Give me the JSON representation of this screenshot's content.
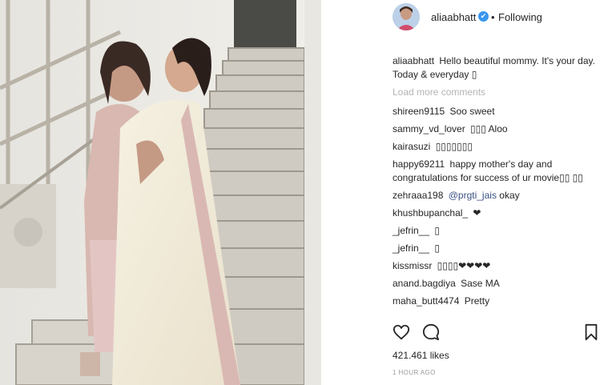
{
  "post": {
    "image_alt": "Two women embracing on a staircase",
    "header": {
      "username": "aliaabhatt",
      "verified_mark": "✔",
      "separator": "•",
      "follow_status": "Following"
    },
    "caption": {
      "username": "aliaabhatt",
      "text": "Hello beautiful mommy. It's your day. Today & everyday ▯"
    },
    "load_more": "Load more comments",
    "comments": [
      {
        "user": "shireen9115",
        "text": "Soo sweet"
      },
      {
        "user": "sammy_vd_lover",
        "text": "▯▯▯ Aloo"
      },
      {
        "user": "kairasuzi",
        "text": "▯▯▯▯▯▯▯"
      },
      {
        "user": "happy69211",
        "text": "happy mother's day and congratulations for success of ur movie▯▯ ▯▯"
      },
      {
        "user": "zehraaa198",
        "mention": "@prgti_jais",
        "text": "okay"
      },
      {
        "user": "khushbupanchal_",
        "text": "❤"
      },
      {
        "user": "_jefrin__",
        "text": "▯"
      },
      {
        "user": "_jefrin__",
        "text": "▯"
      },
      {
        "user": "kissmissr",
        "text": "▯▯▯▯❤❤❤❤"
      },
      {
        "user": "anand.bagdiya",
        "text": "Sase MA"
      },
      {
        "user": "maha_butt4474",
        "text": "Pretty"
      }
    ],
    "actions": {
      "like_icon": "heart-outline-icon",
      "comment_icon": "comment-bubble-icon",
      "save_icon": "bookmark-icon"
    },
    "likes": "421.461 likes",
    "timestamp": "1 HOUR AGO"
  }
}
